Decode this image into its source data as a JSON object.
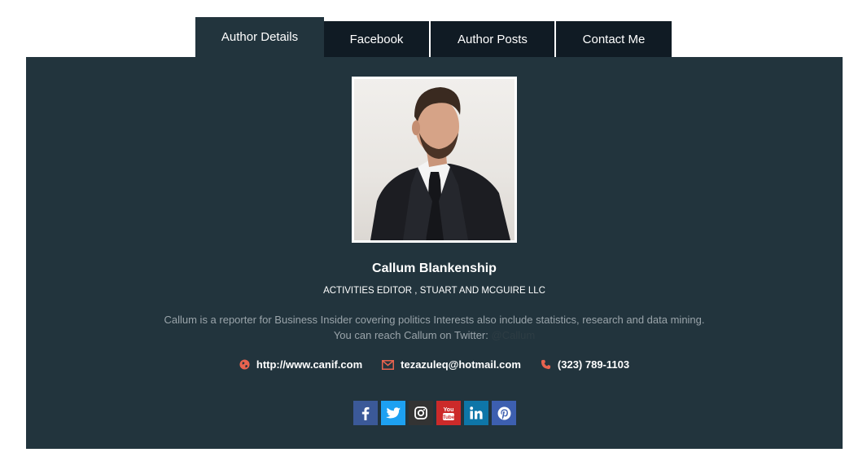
{
  "tabs": [
    {
      "label": "Author Details",
      "active": true
    },
    {
      "label": "Facebook",
      "active": false
    },
    {
      "label": "Author Posts",
      "active": false
    },
    {
      "label": "Contact Me",
      "active": false
    }
  ],
  "author": {
    "name": "Callum Blankenship",
    "role": "ACTIVITIES EDITOR , STUART AND MCGUIRE LLC",
    "bio_line1": "Callum is a reporter for Business Insider covering politics Interests also include statistics, research and data mining.",
    "bio_line2_prefix": "You can reach Callum on Twitter:",
    "twitter_handle": "@Callum"
  },
  "contacts": {
    "website": "http://www.canif.com",
    "email": "tezazuleq@hotmail.com",
    "phone": "(323) 789-1103"
  },
  "colors": {
    "panel_bg": "#22343d",
    "tab_bg": "#101b24",
    "accent_icon": "#e8634f",
    "facebook": "#3b5998",
    "twitter": "#1da1f2",
    "instagram": "#333333",
    "youtube": "#cc2a2a",
    "linkedin": "#0e76a8",
    "pinterest": "#3d5fb0"
  },
  "social": [
    "facebook-icon",
    "twitter-icon",
    "instagram-icon",
    "youtube-icon",
    "linkedin-icon",
    "pinterest-icon"
  ]
}
